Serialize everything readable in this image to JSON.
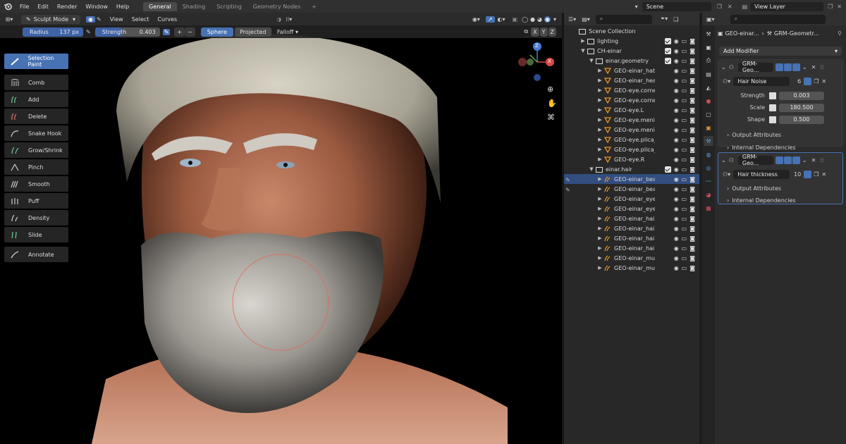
{
  "menu": [
    "File",
    "Edit",
    "Render",
    "Window",
    "Help"
  ],
  "workspaces": [
    {
      "label": "General",
      "active": true
    },
    {
      "label": "Shading",
      "active": false
    },
    {
      "label": "Scripting",
      "active": false
    },
    {
      "label": "Geometry Nodes",
      "active": false
    }
  ],
  "scene": {
    "label": "Scene",
    "view_layer": "View Layer"
  },
  "viewport_header": {
    "mode": "Sculpt Mode",
    "menus": [
      "View",
      "Select",
      "Curves"
    ]
  },
  "tool_settings": {
    "radius_label": "Radius",
    "radius_value": "137 px",
    "strength_label": "Strength",
    "strength_value": "0.403",
    "plus": "+",
    "minus": "−",
    "sphere": "Sphere",
    "projected": "Projected",
    "falloff": "Falloff",
    "axes": [
      "X",
      "Y",
      "Z"
    ]
  },
  "tools": [
    "Selection Paint",
    "Comb",
    "Add",
    "Delete",
    "Snake Hook",
    "Grow/Shrink",
    "Pinch",
    "Smooth",
    "Puff",
    "Density",
    "Slide",
    "Annotate"
  ],
  "gizmo": {
    "z": "Z",
    "y": "Y",
    "x": "X"
  },
  "outliner": {
    "rows": [
      {
        "name": "Scene Collection",
        "indent": 0,
        "icon": "collection",
        "arrow": "",
        "sel": false
      },
      {
        "name": "lighting",
        "indent": 1,
        "icon": "collection",
        "arrow": "▶",
        "sel": false
      },
      {
        "name": "CH-einar",
        "indent": 1,
        "icon": "collection",
        "arrow": "▼",
        "sel": false
      },
      {
        "name": "einar.geometry",
        "indent": 2,
        "icon": "collection",
        "arrow": "▼",
        "sel": false
      },
      {
        "name": "GEO-einar_hat",
        "indent": 3,
        "icon": "mesh",
        "arrow": "▶",
        "sel": false
      },
      {
        "name": "GEO-einar_heac",
        "indent": 3,
        "icon": "mesh",
        "arrow": "▶",
        "sel": false
      },
      {
        "name": "GEO-eye.cornea",
        "indent": 3,
        "icon": "mesh",
        "arrow": "▶",
        "sel": false
      },
      {
        "name": "GEO-eye.cornea",
        "indent": 3,
        "icon": "mesh",
        "arrow": "▶",
        "sel": false
      },
      {
        "name": "GEO-eye.L",
        "indent": 3,
        "icon": "mesh",
        "arrow": "▶",
        "sel": false
      },
      {
        "name": "GEO-eye.menisc",
        "indent": 3,
        "icon": "mesh",
        "arrow": "▶",
        "sel": false
      },
      {
        "name": "GEO-eye.menisc",
        "indent": 3,
        "icon": "mesh",
        "arrow": "▶",
        "sel": false
      },
      {
        "name": "GEO-eye.plica_s",
        "indent": 3,
        "icon": "mesh",
        "arrow": "▶",
        "sel": false
      },
      {
        "name": "GEO-eye.plica_s",
        "indent": 3,
        "icon": "mesh",
        "arrow": "▶",
        "sel": false
      },
      {
        "name": "GEO-eye.R",
        "indent": 3,
        "icon": "mesh",
        "arrow": "▶",
        "sel": false
      },
      {
        "name": "einar.hair",
        "indent": 2,
        "icon": "collection",
        "arrow": "▼",
        "sel": false
      },
      {
        "name": "GEO-einar_bear",
        "indent": 3,
        "icon": "curves",
        "arrow": "▶",
        "sel": true
      },
      {
        "name": "GEO-einar_bear",
        "indent": 3,
        "icon": "curves",
        "arrow": "▶",
        "sel": false
      },
      {
        "name": "GEO-einar_eyeb",
        "indent": 3,
        "icon": "curves",
        "arrow": "▶",
        "sel": false
      },
      {
        "name": "GEO-einar_eyela",
        "indent": 3,
        "icon": "curves",
        "arrow": "▶",
        "sel": false
      },
      {
        "name": "GEO-einar_hair",
        "indent": 3,
        "icon": "curves",
        "arrow": "▶",
        "sel": false
      },
      {
        "name": "GEO-einar_hair.",
        "indent": 3,
        "icon": "curves",
        "arrow": "▶",
        "sel": false
      },
      {
        "name": "GEO-einar_hair_",
        "indent": 3,
        "icon": "curves",
        "arrow": "▶",
        "sel": false
      },
      {
        "name": "GEO-einar_hair_",
        "indent": 3,
        "icon": "curves",
        "arrow": "▶",
        "sel": false
      },
      {
        "name": "GEO-einar_must",
        "indent": 3,
        "icon": "curves",
        "arrow": "▶",
        "sel": false
      },
      {
        "name": "GEO-einar_must",
        "indent": 3,
        "icon": "curves",
        "arrow": "▶",
        "sel": false
      }
    ]
  },
  "properties": {
    "breadcrumb_object": "GEO-einar...",
    "breadcrumb_modifier": "GRM-Geometr...",
    "add_modifier": "Add Modifier",
    "modifier1": {
      "name": "GRM-Geo...",
      "group": "Hair Noise",
      "users": "6",
      "fields": [
        {
          "label": "Strength",
          "value": "0.003"
        },
        {
          "label": "Scale",
          "value": "180.500"
        },
        {
          "label": "Shape",
          "value": "0.500"
        }
      ],
      "output": "Output Attributes",
      "internal": "Internal Dependencies"
    },
    "modifier2": {
      "name": "GRM-Geo...",
      "group": "Hair thickness",
      "users": "10",
      "output": "Output Attributes",
      "internal": "Internal Dependencies"
    }
  }
}
